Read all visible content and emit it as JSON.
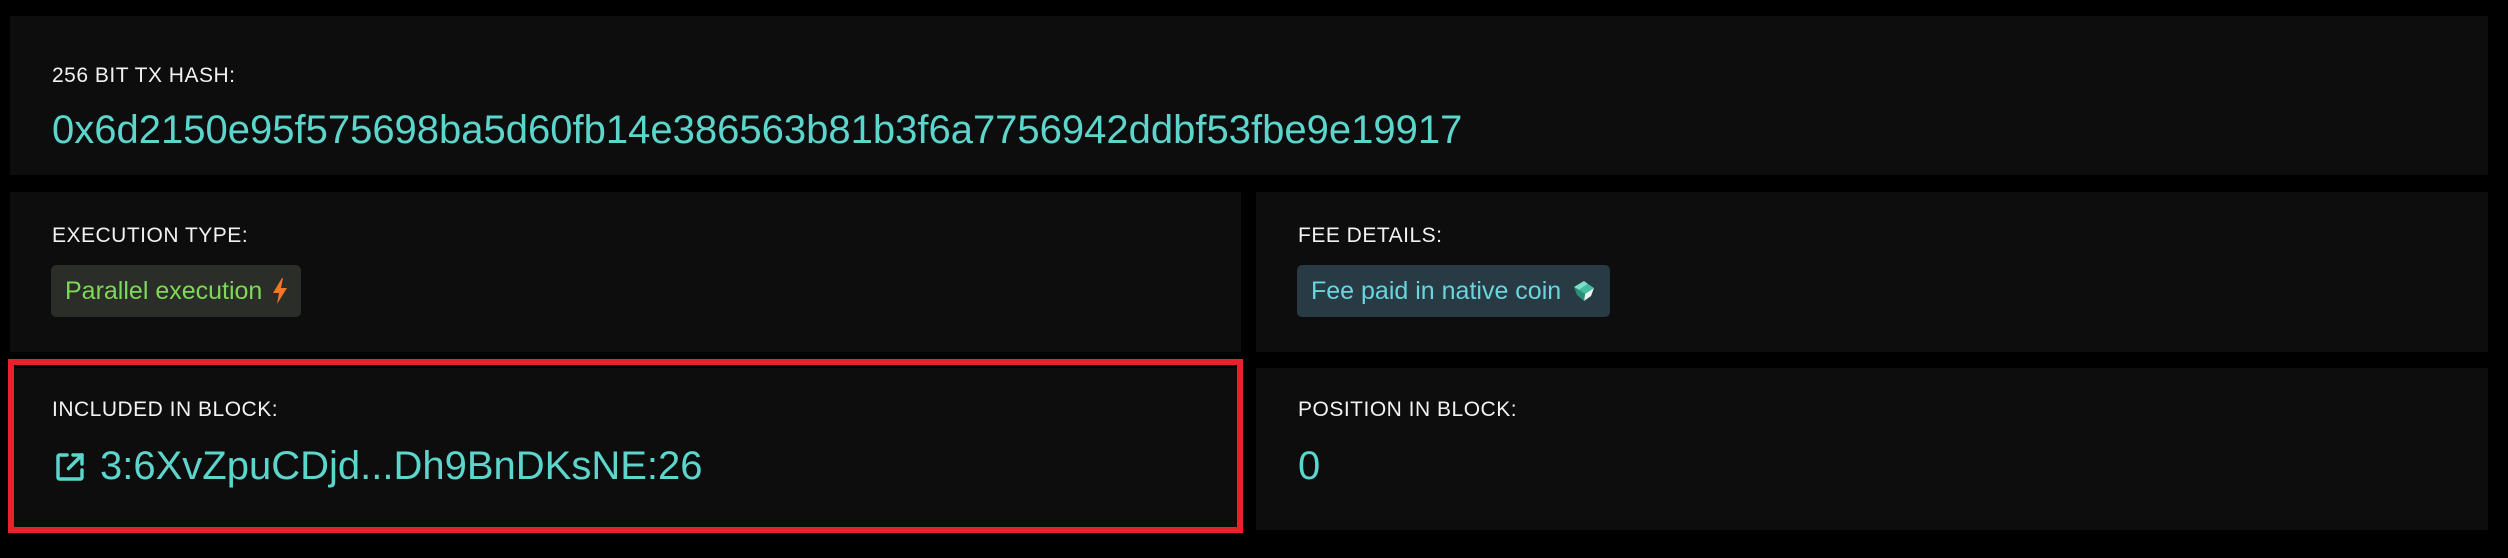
{
  "hash_card": {
    "label": "256 BIT TX HASH:",
    "value": "0x6d2150e95f575698ba5d60fb14e386563b81b3f6a7756942ddbf53fbe9e19917"
  },
  "execution_card": {
    "label": "EXECUTION TYPE:",
    "badge_text": "Parallel execution",
    "badge_icon": "lightning-bolt-icon",
    "badge_color": "#7ed957",
    "icon_color": "#f0772b"
  },
  "fee_card": {
    "label": "FEE DETAILS:",
    "badge_text": "Fee paid in native coin",
    "badge_icon": "native-coin-icon",
    "badge_color": "#6ad5dd"
  },
  "block_card": {
    "label": "INCLUDED IN BLOCK:",
    "link_icon": "external-link-icon",
    "value": "3:6XvZpuCDjd...Dh9BnDKsNE:26"
  },
  "position_card": {
    "label": "POSITION IN BLOCK:",
    "value": "0"
  },
  "colors": {
    "accent": "#5cd6cc",
    "highlight": "#e8212d",
    "card_bg": "#0d0d0d",
    "page_bg": "#000000"
  }
}
